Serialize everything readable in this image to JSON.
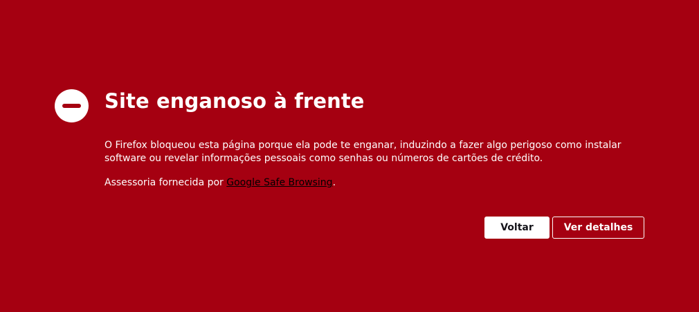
{
  "page": {
    "title": "Site enganoso à frente",
    "description": "O Firefox bloqueou esta página porque ela pode te enganar, induzindo a fazer algo perigoso como instalar software ou revelar informações pessoais como senhas ou números de cartões de crédito.",
    "advisory_prefix": "Assessoria fornecida por ",
    "advisory_link": "Google Safe Browsing",
    "advisory_suffix": ".",
    "icon": "blocked-minus-circle-icon"
  },
  "buttons": {
    "back_label": "Voltar",
    "details_label": "Ver detalhes"
  },
  "colors": {
    "background": "#a50011",
    "text": "#ffffff",
    "link": "#000000"
  }
}
